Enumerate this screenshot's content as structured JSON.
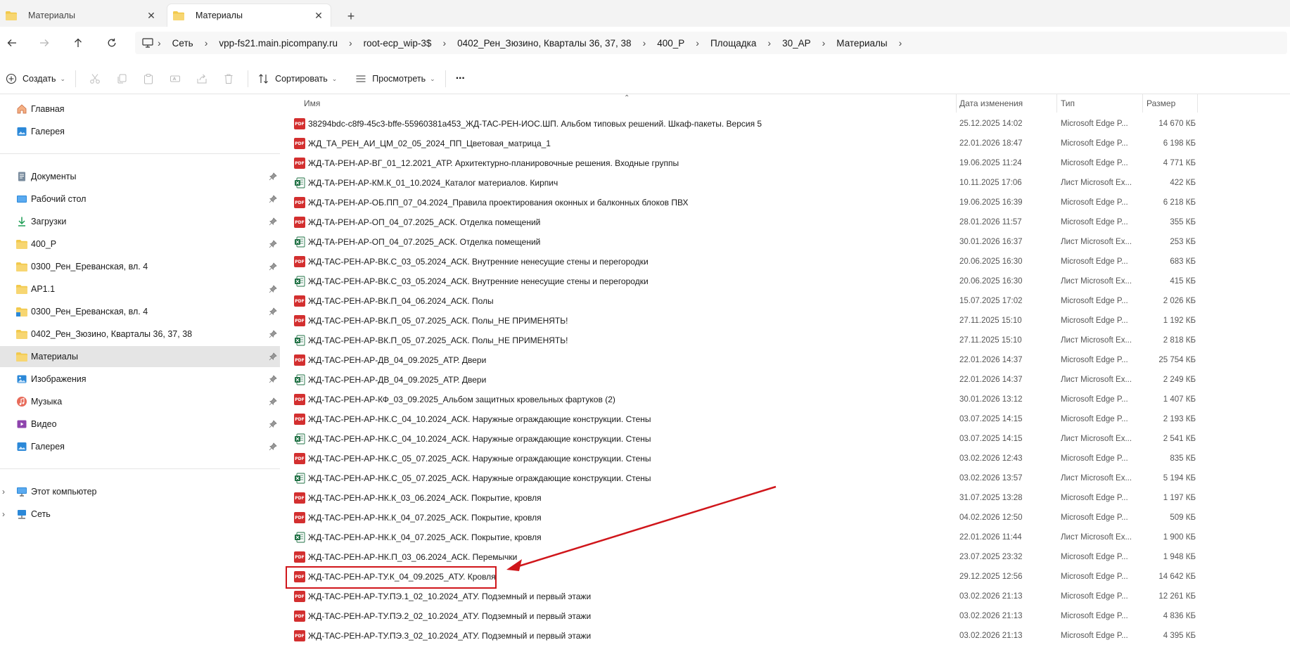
{
  "tabs": [
    {
      "label": "Материалы",
      "close": "✕"
    },
    {
      "label": "Материалы",
      "close": "✕"
    }
  ],
  "new_tab": "+",
  "breadcrumb": [
    "Сеть",
    "vpp-fs21.main.picompany.ru",
    "root-ecp_wip-3$",
    "0402_Рен_Зюзино, Кварталы 36, 37, 38",
    "400_Р",
    "Площадка",
    "30_АР",
    "Материалы"
  ],
  "toolbar": {
    "create_label": "Создать",
    "sort_label": "Сортировать",
    "view_label": "Просмотреть",
    "more": "···"
  },
  "sidebar": {
    "top": [
      {
        "label": "Главная",
        "icon": "home-icon"
      },
      {
        "label": "Галерея",
        "icon": "gallery-icon"
      }
    ],
    "pinned": [
      {
        "label": "Документы",
        "icon": "documents-icon"
      },
      {
        "label": "Рабочий стол",
        "icon": "desktop-icon"
      },
      {
        "label": "Загрузки",
        "icon": "downloads-icon"
      },
      {
        "label": "400_Р",
        "icon": "folder-icon"
      },
      {
        "label": "0300_Рен_Ереванская, вл. 4",
        "icon": "folder-icon"
      },
      {
        "label": "АР1.1",
        "icon": "folder-icon"
      },
      {
        "label": "0300_Рен_Ереванская, вл. 4",
        "icon": "folder-shortcut-icon"
      },
      {
        "label": "0402_Рен_Зюзино, Кварталы 36, 37, 38",
        "icon": "folder-icon"
      },
      {
        "label": "Материалы",
        "icon": "folder-icon"
      },
      {
        "label": "Изображения",
        "icon": "pictures-icon"
      },
      {
        "label": "Музыка",
        "icon": "music-icon"
      },
      {
        "label": "Видео",
        "icon": "video-icon"
      },
      {
        "label": "Галерея",
        "icon": "gallery-icon"
      }
    ],
    "bottom": [
      {
        "label": "Этот компьютер",
        "icon": "computer-icon"
      },
      {
        "label": "Сеть",
        "icon": "network-icon"
      }
    ],
    "selected": "Материалы"
  },
  "columns": {
    "name": "Имя",
    "date": "Дата изменения",
    "type": "Тип",
    "size": "Размер"
  },
  "files": [
    {
      "name": "38294bdc-c8f9-45c3-bffe-55960381a453_ЖД-ТАС-РЕН-ИОС.ШП. Альбом типовых решений. Шкаф-пакеты. Версия 5",
      "date": "25.12.2025 14:02",
      "type": "Microsoft Edge P...",
      "size": "14 670 КБ",
      "kind": "pdf"
    },
    {
      "name": "ЖД_ТА_РЕН_АИ_ЦМ_02_05_2024_ПП_Цветовая_матрица_1",
      "date": "22.01.2026 18:47",
      "type": "Microsoft Edge P...",
      "size": "6 198 КБ",
      "kind": "pdf"
    },
    {
      "name": "ЖД-ТА-РЕН-АР-ВГ_01_12.2021_АТР. Архитектурно-планировочные решения. Входные группы",
      "date": "19.06.2025 11:24",
      "type": "Microsoft Edge P...",
      "size": "4 771 КБ",
      "kind": "pdf"
    },
    {
      "name": "ЖД-ТА-РЕН-АР-КМ.К_01_10.2024_Каталог материалов. Кирпич",
      "date": "10.11.2025 17:06",
      "type": "Лист Microsoft Ex...",
      "size": "422 КБ",
      "kind": "xls"
    },
    {
      "name": "ЖД-ТА-РЕН-АР-ОБ.ПП_07_04.2024_Правила проектирования оконных и балконных блоков ПВХ",
      "date": "19.06.2025 16:39",
      "type": "Microsoft Edge P...",
      "size": "6 218 КБ",
      "kind": "pdf"
    },
    {
      "name": "ЖД-ТА-РЕН-АР-ОП_04_07.2025_АСК. Отделка помещений",
      "date": "28.01.2026 11:57",
      "type": "Microsoft Edge P...",
      "size": "355 КБ",
      "kind": "pdf"
    },
    {
      "name": "ЖД-ТА-РЕН-АР-ОП_04_07.2025_АСК. Отделка помещений",
      "date": "30.01.2026 16:37",
      "type": "Лист Microsoft Ex...",
      "size": "253 КБ",
      "kind": "xls"
    },
    {
      "name": "ЖД-ТАС-РЕН-АР-ВК.С_03_05.2024_АСК. Внутренние ненесущие стены и перегородки",
      "date": "20.06.2025 16:30",
      "type": "Microsoft Edge P...",
      "size": "683 КБ",
      "kind": "pdf"
    },
    {
      "name": "ЖД-ТАС-РЕН-АР-ВК.С_03_05.2024_АСК. Внутренние ненесущие стены и перегородки",
      "date": "20.06.2025 16:30",
      "type": "Лист Microsoft Ex...",
      "size": "415 КБ",
      "kind": "xls"
    },
    {
      "name": "ЖД-ТАС-РЕН-АР-ВК.П_04_06.2024_АСК. Полы",
      "date": "15.07.2025 17:02",
      "type": "Microsoft Edge P...",
      "size": "2 026 КБ",
      "kind": "pdf"
    },
    {
      "name": "ЖД-ТАС-РЕН-АР-ВК.П_05_07.2025_АСК. Полы_НЕ ПРИМЕНЯТЬ!",
      "date": "27.11.2025 15:10",
      "type": "Microsoft Edge P...",
      "size": "1 192 КБ",
      "kind": "pdf"
    },
    {
      "name": "ЖД-ТАС-РЕН-АР-ВК.П_05_07.2025_АСК. Полы_НЕ ПРИМЕНЯТЬ!",
      "date": "27.11.2025 15:10",
      "type": "Лист Microsoft Ex...",
      "size": "2 818 КБ",
      "kind": "xls"
    },
    {
      "name": "ЖД-ТАС-РЕН-АР-ДВ_04_09.2025_АТР. Двери",
      "date": "22.01.2026 14:37",
      "type": "Microsoft Edge P...",
      "size": "25 754 КБ",
      "kind": "pdf"
    },
    {
      "name": "ЖД-ТАС-РЕН-АР-ДВ_04_09.2025_АТР. Двери",
      "date": "22.01.2026 14:37",
      "type": "Лист Microsoft Ex...",
      "size": "2 249 КБ",
      "kind": "xls"
    },
    {
      "name": "ЖД-ТАС-РЕН-АР-КФ_03_09.2025_Альбом защитных кровельных фартуков (2)",
      "date": "30.01.2026 13:12",
      "type": "Microsoft Edge P...",
      "size": "1 407 КБ",
      "kind": "pdf"
    },
    {
      "name": "ЖД-ТАС-РЕН-АР-НК.С_04_10.2024_АСК. Наружные ограждающие конструкции. Стены",
      "date": "03.07.2025 14:15",
      "type": "Microsoft Edge P...",
      "size": "2 193 КБ",
      "kind": "pdf"
    },
    {
      "name": "ЖД-ТАС-РЕН-АР-НК.С_04_10.2024_АСК. Наружные ограждающие конструкции. Стены",
      "date": "03.07.2025 14:15",
      "type": "Лист Microsoft Ex...",
      "size": "2 541 КБ",
      "kind": "xls"
    },
    {
      "name": "ЖД-ТАС-РЕН-АР-НК.С_05_07.2025_АСК. Наружные ограждающие конструкции. Стены",
      "date": "03.02.2026 12:43",
      "type": "Microsoft Edge P...",
      "size": "835 КБ",
      "kind": "pdf"
    },
    {
      "name": "ЖД-ТАС-РЕН-АР-НК.С_05_07.2025_АСК. Наружные ограждающие конструкции. Стены",
      "date": "03.02.2026 13:57",
      "type": "Лист Microsoft Ex...",
      "size": "5 194 КБ",
      "kind": "xls"
    },
    {
      "name": "ЖД-ТАС-РЕН-АР-НК.К_03_06.2024_АСК. Покрытие, кровля",
      "date": "31.07.2025 13:28",
      "type": "Microsoft Edge P...",
      "size": "1 197 КБ",
      "kind": "pdf"
    },
    {
      "name": "ЖД-ТАС-РЕН-АР-НК.К_04_07.2025_АСК. Покрытие, кровля",
      "date": "04.02.2026 12:50",
      "type": "Microsoft Edge P...",
      "size": "509 КБ",
      "kind": "pdf"
    },
    {
      "name": "ЖД-ТАС-РЕН-АР-НК.К_04_07.2025_АСК. Покрытие, кровля",
      "date": "22.01.2026 11:44",
      "type": "Лист Microsoft Ex...",
      "size": "1 900 КБ",
      "kind": "xls"
    },
    {
      "name": "ЖД-ТАС-РЕН-АР-НК.П_03_06.2024_АСК. Перемычки",
      "date": "23.07.2025 23:32",
      "type": "Microsoft Edge P...",
      "size": "1 948 КБ",
      "kind": "pdf"
    },
    {
      "name": "ЖД-ТАС-РЕН-АР-ТУ.К_04_09.2025_АТУ. Кровля",
      "date": "29.12.2025 12:56",
      "type": "Microsoft Edge P...",
      "size": "14 642 КБ",
      "kind": "pdf"
    },
    {
      "name": "ЖД-ТАС-РЕН-АР-ТУ.ПЭ.1_02_10.2024_АТУ. Подземный и первый этажи",
      "date": "03.02.2026 21:13",
      "type": "Microsoft Edge P...",
      "size": "12 261 КБ",
      "kind": "pdf"
    },
    {
      "name": "ЖД-ТАС-РЕН-АР-ТУ.ПЭ.2_02_10.2024_АТУ. Подземный и первый этажи",
      "date": "03.02.2026 21:13",
      "type": "Microsoft Edge P...",
      "size": "4 836 КБ",
      "kind": "pdf"
    },
    {
      "name": "ЖД-ТАС-РЕН-АР-ТУ.ПЭ.3_02_10.2024_АТУ. Подземный и первый этажи",
      "date": "03.02.2026 21:13",
      "type": "Microsoft Edge P...",
      "size": "4 395 КБ",
      "kind": "pdf"
    }
  ],
  "pdf_badge": "PDF",
  "colors": {
    "accent": "#0067c0",
    "pdf": "#d32f2f",
    "excel": "#1d6f42",
    "folder": "#f2c94c",
    "annotation": "#d0161b"
  }
}
